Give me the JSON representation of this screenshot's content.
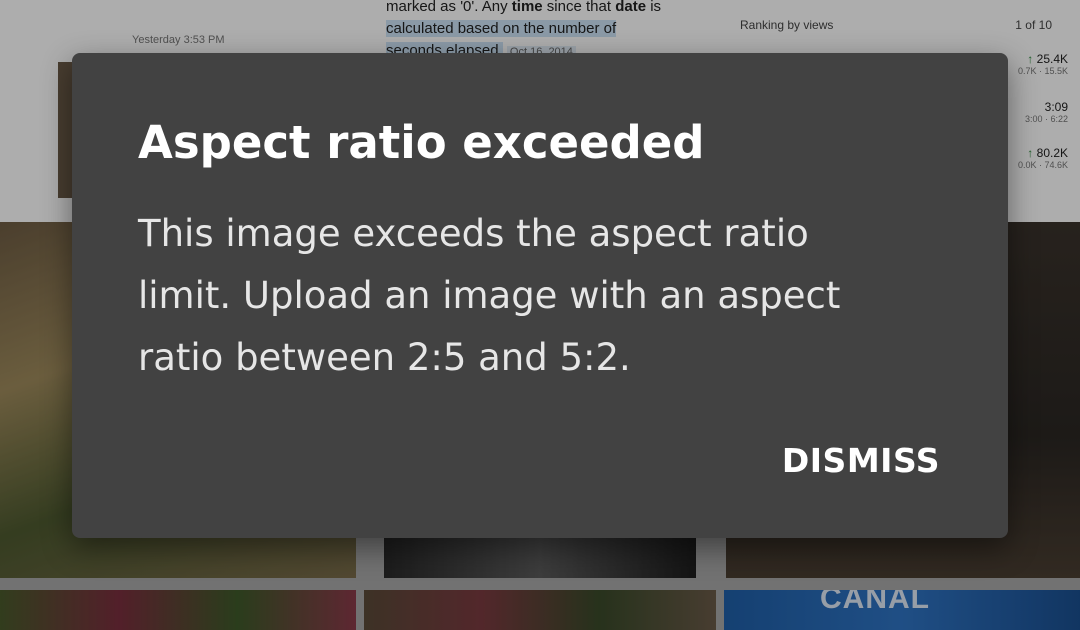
{
  "background": {
    "left_card": {
      "timestamp": "Yesterday 3:53 PM"
    },
    "mid_card": {
      "line1_pre": "marked as '0'. Any ",
      "line1_bold1": "time",
      "line1_mid": " since that ",
      "line1_bold2": "date",
      "line1_post": " is",
      "line2": "calculated based on the number of",
      "line3": "seconds elapsed.",
      "date": "Oct 16, 2014"
    },
    "right_card": {
      "heading": "Ranking by views",
      "page": "1 of 10",
      "rows": [
        {
          "arrow": "↑",
          "value": "25.4K",
          "range": "0.7K · 15.5K"
        },
        {
          "arrow": "",
          "value": "3:09",
          "range": "3:00 · 6:22"
        },
        {
          "arrow": "↑",
          "value": "80.2K",
          "range": "0.0K · 74.6K"
        }
      ]
    },
    "photo_text": "CANAL"
  },
  "dialog": {
    "title": "Aspect ratio exceeded",
    "body": "This image exceeds the aspect ratio limit. Upload an image with an aspect ratio between 2:5 and 5:2.",
    "dismiss_label": "DISMISS",
    "colors": {
      "surface": "#424242",
      "title": "#ffffff",
      "body": "#e6e6e6"
    }
  }
}
